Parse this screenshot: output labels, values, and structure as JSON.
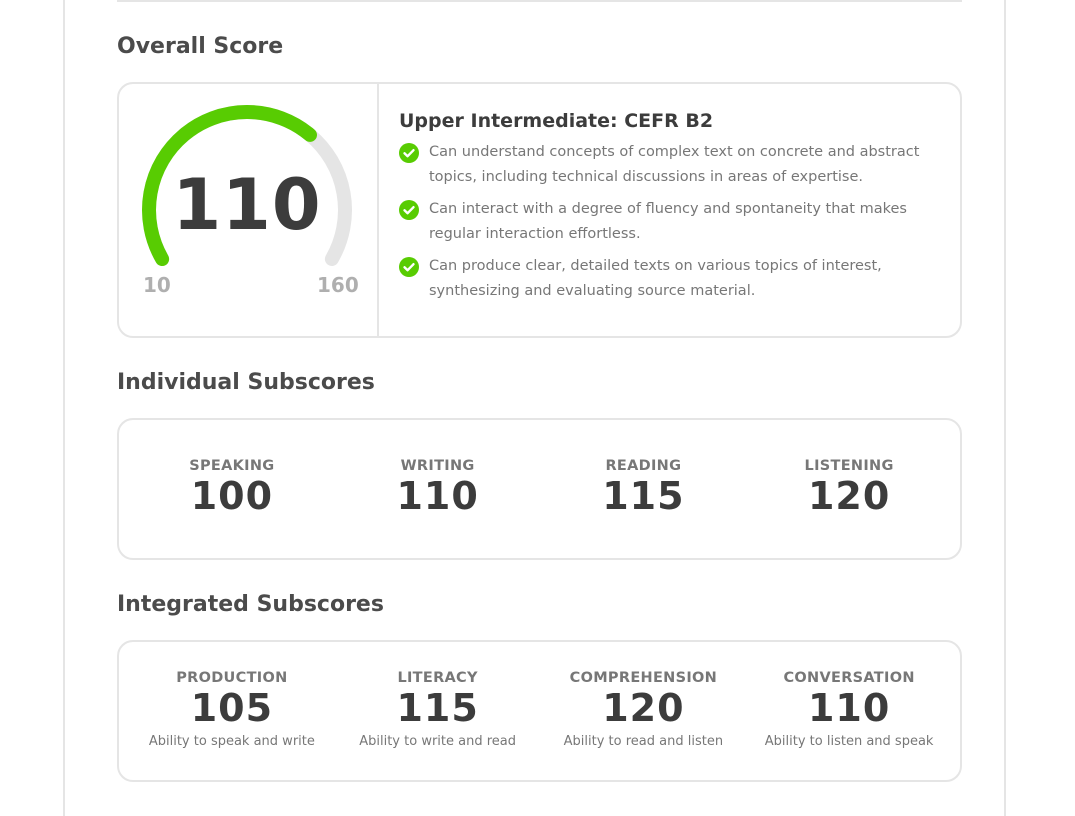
{
  "overall": {
    "title": "Overall Score",
    "score": "110",
    "min_label": "10",
    "max_label": "160",
    "gauge": {
      "min": 10,
      "max": 160,
      "value": 110,
      "fill_color": "#58cc02",
      "track_color": "#e5e5e5"
    },
    "level": "Upper Intermediate: CEFR B2",
    "abilities": [
      "Can understand concepts of complex text on concrete and abstract topics, including technical discussions in areas of expertise.",
      "Can interact with a degree of fluency and spontaneity that makes regular interaction effortless.",
      "Can produce clear, detailed texts on various topics of interest, synthesizing and evaluating source material."
    ],
    "check_icon": "check-circle-icon",
    "check_color": "#58cc02"
  },
  "individual": {
    "title": "Individual Subscores",
    "items": [
      {
        "label": "SPEAKING",
        "value": "100"
      },
      {
        "label": "WRITING",
        "value": "110"
      },
      {
        "label": "READING",
        "value": "115"
      },
      {
        "label": "LISTENING",
        "value": "120"
      }
    ]
  },
  "integrated": {
    "title": "Integrated Subscores",
    "items": [
      {
        "label": "PRODUCTION",
        "value": "105",
        "desc": "Ability to speak and write"
      },
      {
        "label": "LITERACY",
        "value": "115",
        "desc": "Ability to write and read"
      },
      {
        "label": "COMPREHENSION",
        "value": "120",
        "desc": "Ability to read and listen"
      },
      {
        "label": "CONVERSATION",
        "value": "110",
        "desc": "Ability to listen and speak"
      }
    ]
  }
}
